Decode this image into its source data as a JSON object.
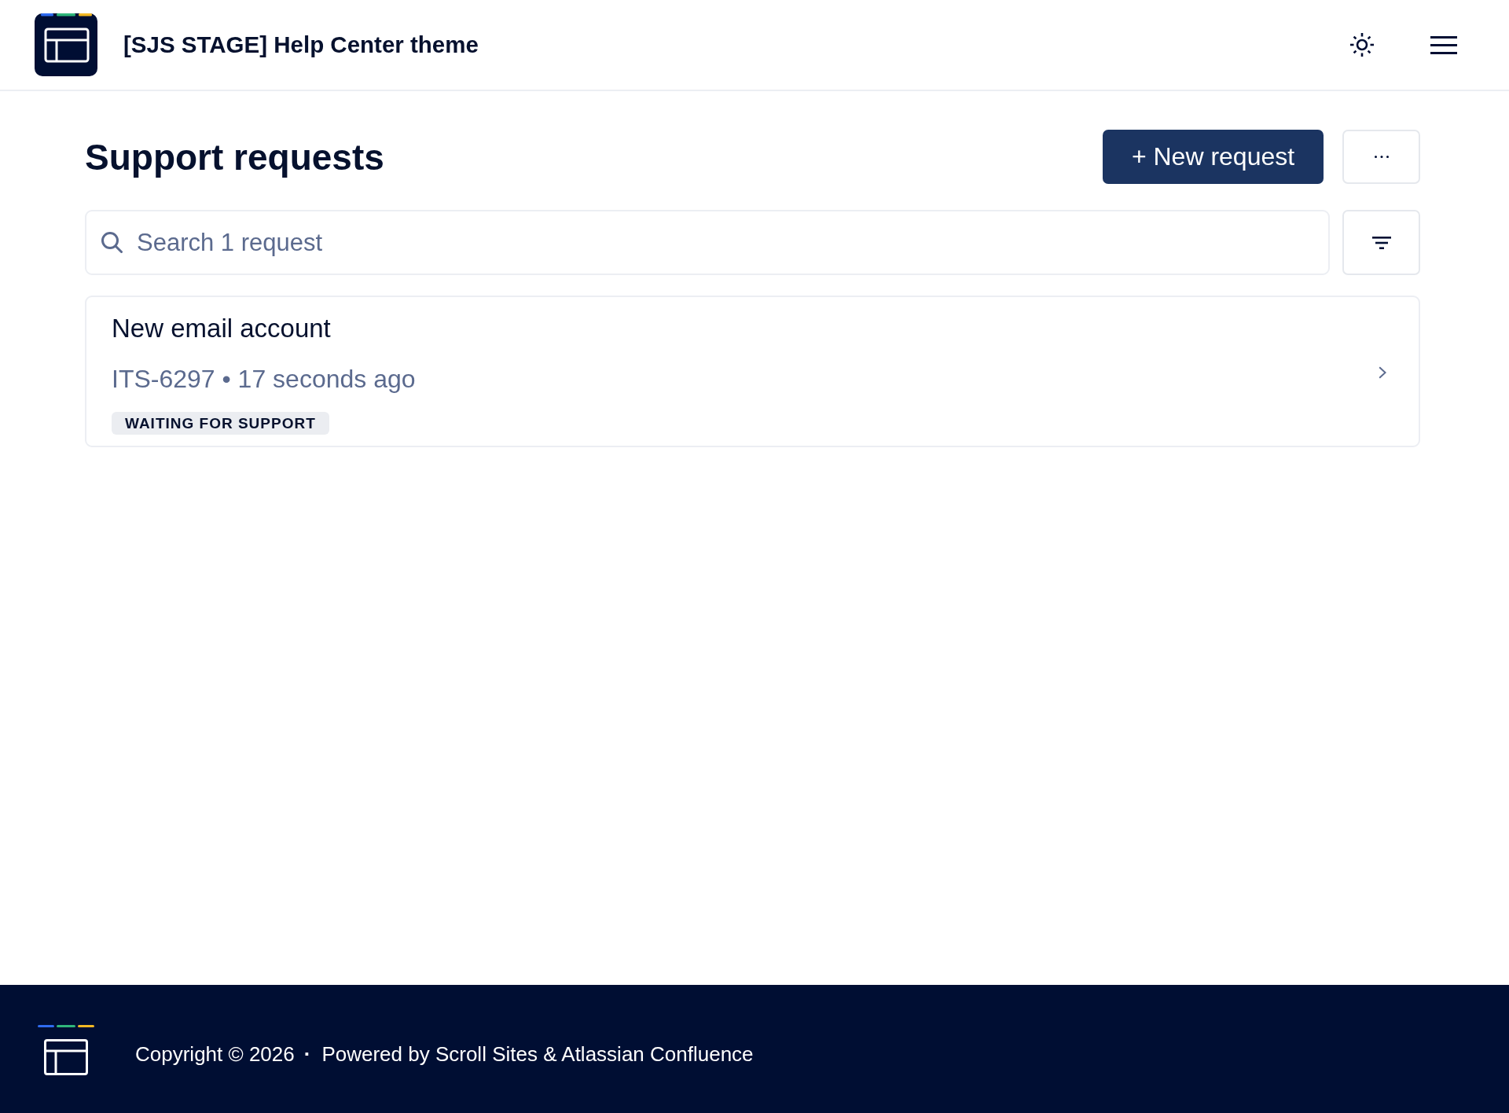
{
  "header": {
    "site_title": "[SJS STAGE] Help Center theme"
  },
  "page": {
    "title": "Support requests",
    "new_request_button": "+ New request",
    "search": {
      "placeholder": "Search 1 request"
    },
    "requests": [
      {
        "title": "New email account",
        "meta": "ITS-6297 • 17 seconds ago",
        "status": "WAITING FOR SUPPORT"
      }
    ]
  },
  "footer": {
    "copyright": "Copyright © 2026",
    "separator": "·",
    "powered_by": "Powered by Scroll Sites & Atlassian Confluence"
  }
}
